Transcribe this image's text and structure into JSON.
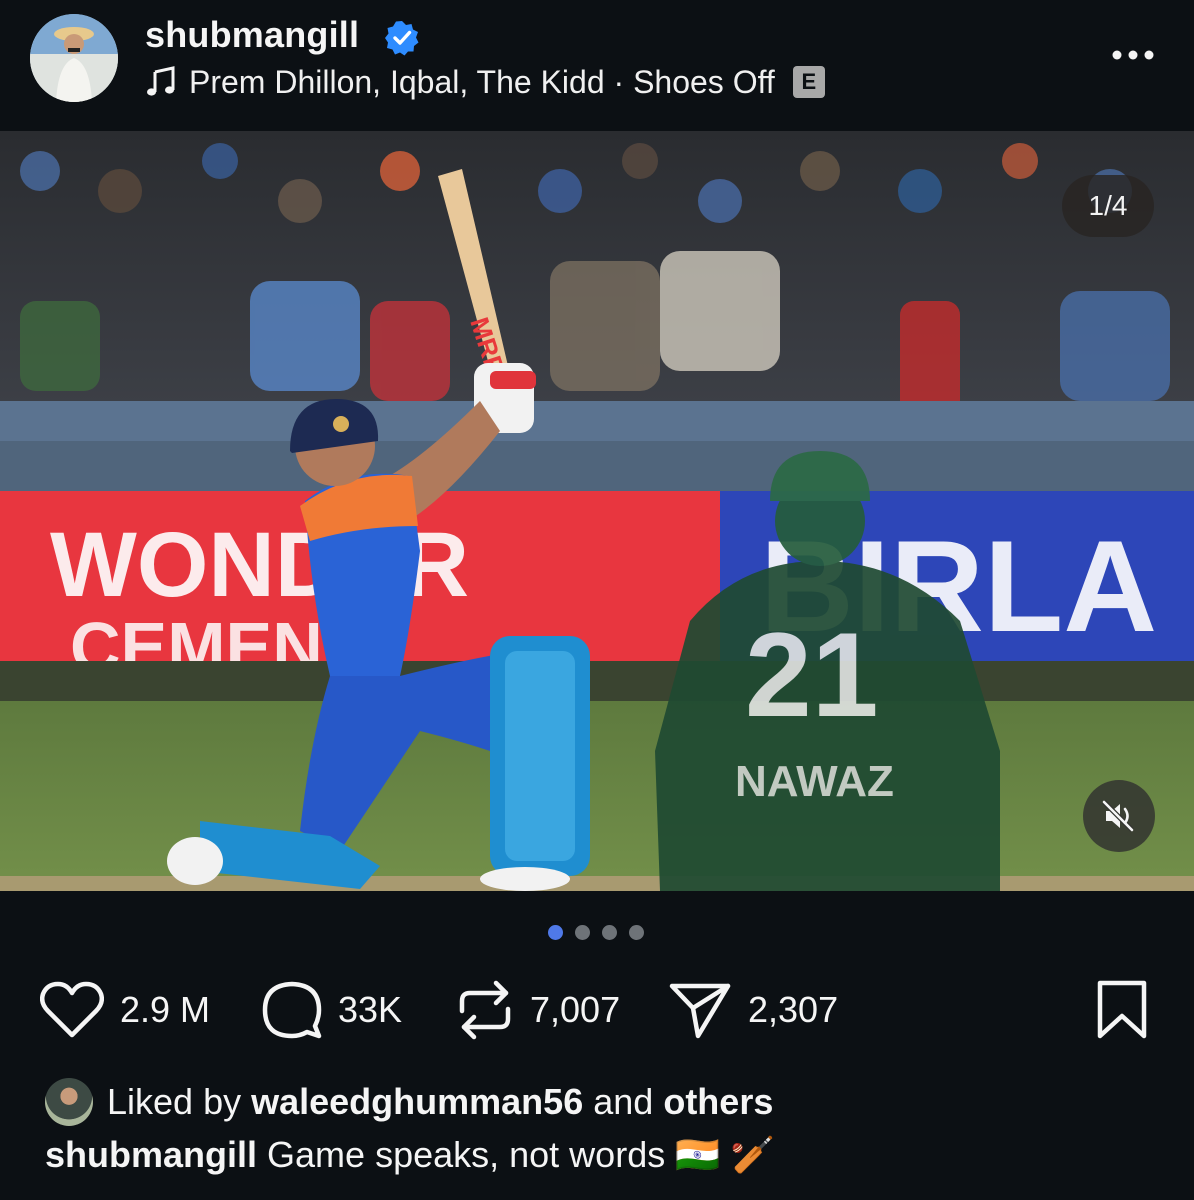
{
  "post": {
    "username": "shubmangill",
    "music": "Prem Dhillon, Iqbal, The Kidd · Shoes Off",
    "explicit_badge": "E",
    "image_counter": "1/4",
    "carousel": {
      "total": 4,
      "active": 1
    },
    "icons": {
      "verified": "verified-badge-icon",
      "music": "music-note-icon",
      "more": "more-options-icon",
      "mute": "speaker-muted-icon",
      "like": "heart-icon",
      "comment": "comment-bubble-icon",
      "repost": "repost-icon",
      "share": "send-icon",
      "save": "bookmark-icon"
    },
    "photo_text": {
      "jersey_number": "21",
      "jersey_name": "NAWAZ",
      "bat_brand": "MRF",
      "board_left": [
        "WONDER",
        "CEMENT"
      ],
      "board_right": "BIRLA"
    }
  },
  "actions": {
    "likes": "2.9 M",
    "comments": "33K",
    "reposts": "7,007",
    "shares": "2,307"
  },
  "footer": {
    "liked_by_prefix": "Liked by",
    "liked_by_user": "waleedghumman56",
    "and_text": "and",
    "others": "others",
    "caption_user": "shubmangill",
    "caption_text": "Game speaks, not words",
    "caption_emoji_flag": "🇮🇳",
    "caption_emoji_cricket": "🏏"
  },
  "colors": {
    "background": "#0c1014",
    "verified_blue": "#2e8cff",
    "active_dot": "#4f79e8",
    "india_jersey_blue": "#2a63d6",
    "india_jersey_orange": "#f07a36",
    "pakistan_green": "#1f4a32"
  }
}
